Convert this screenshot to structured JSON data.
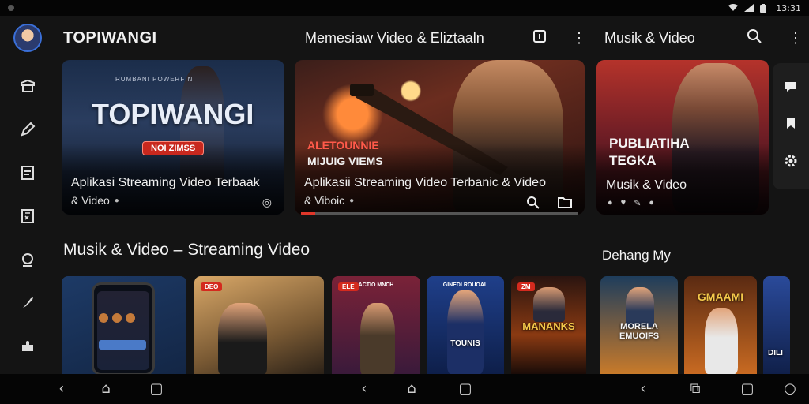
{
  "status_bar": {
    "time": "13:31"
  },
  "app": {
    "title": "TOPIWANGI"
  },
  "header": {
    "middle_title": "Memesiaw Video & Eliztaaln",
    "right_title": "Musik & Video"
  },
  "featured": [
    {
      "top_small": "RUMBANI POWERFIN",
      "big_title": "TOPIWANGI",
      "tag": "NOI ZIMSS",
      "caption_line1": "Aplikasi Streaming Video Terbaak",
      "caption_line2": "& Video"
    },
    {
      "overlay_line1": "ALETOUNNIE",
      "overlay_line2": "MIJUIG VIEMS",
      "caption_line1": "Aplikasii Streaming Video Terbanic & Video",
      "caption_line2": "& Viboic",
      "progress_fraction": 0.05
    },
    {
      "overlay_line1": "PUBLIATIHA",
      "overlay_line2": "TEGKA",
      "caption_line1": "Musik & Video"
    }
  ],
  "section": {
    "title": "Musik & Video – Streaming Video",
    "right_label": "Dehang My"
  },
  "thumbnails": [
    {
      "badge": "",
      "title": ""
    },
    {
      "badge": "DEO",
      "title": ""
    },
    {
      "badge": "ELE",
      "strip": "ACTIO MNCH",
      "title": ""
    },
    {
      "badge": "",
      "strip": "GINEDI ROUOAL",
      "title": "TOUNIS"
    },
    {
      "badge": "ZM",
      "title": "MANANKS"
    },
    {
      "badge": "",
      "strip": "",
      "title": "MORELA EMUOIFS"
    },
    {
      "badge": "",
      "title": "GMAAMI"
    },
    {
      "badge": "",
      "title": "DILI"
    }
  ],
  "icons": {
    "rail": [
      "gift-icon",
      "edit-icon",
      "document-icon",
      "receipt-icon",
      "support-icon",
      "rocket-icon",
      "puzzle-icon"
    ],
    "right_rail": [
      "chat-icon",
      "bookmark-icon",
      "settings-icon"
    ]
  },
  "colors": {
    "accent_red": "#e0372a",
    "avatar_ring": "#3a6fd8"
  }
}
